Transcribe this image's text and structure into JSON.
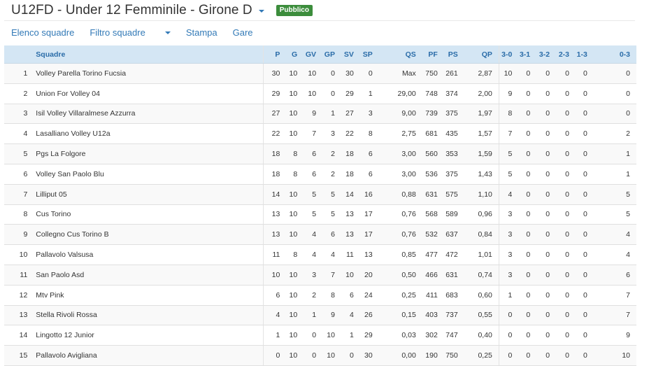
{
  "header": {
    "title": "U12FD - Under 12 Femminile - Girone D",
    "badge": "Pubblico"
  },
  "nav": {
    "items": [
      "Elenco squadre",
      "Filtro squadre",
      "Stampa",
      "Gare"
    ]
  },
  "table": {
    "columns": [
      "",
      "Squadre",
      "P",
      "G",
      "GV",
      "GP",
      "SV",
      "SP",
      "QS",
      "PF",
      "PS",
      "QP",
      "3-0",
      "3-1",
      "3-2",
      "2-3",
      "1-3",
      "0-3"
    ],
    "rows": [
      [
        "1",
        "Volley Parella Torino Fucsia",
        "30",
        "10",
        "10",
        "0",
        "30",
        "0",
        "Max",
        "750",
        "261",
        "2,87",
        "10",
        "0",
        "0",
        "0",
        "0",
        "0"
      ],
      [
        "2",
        "Union For Volley 04",
        "29",
        "10",
        "10",
        "0",
        "29",
        "1",
        "29,00",
        "748",
        "374",
        "2,00",
        "9",
        "0",
        "0",
        "0",
        "0",
        "0"
      ],
      [
        "3",
        "Isil Volley Villaralmese Azzurra",
        "27",
        "10",
        "9",
        "1",
        "27",
        "3",
        "9,00",
        "739",
        "375",
        "1,97",
        "8",
        "0",
        "0",
        "0",
        "0",
        "0"
      ],
      [
        "4",
        "Lasalliano Volley U12a",
        "22",
        "10",
        "7",
        "3",
        "22",
        "8",
        "2,75",
        "681",
        "435",
        "1,57",
        "7",
        "0",
        "0",
        "0",
        "0",
        "2"
      ],
      [
        "5",
        "Pgs La Folgore",
        "18",
        "8",
        "6",
        "2",
        "18",
        "6",
        "3,00",
        "560",
        "353",
        "1,59",
        "5",
        "0",
        "0",
        "0",
        "0",
        "1"
      ],
      [
        "6",
        "Volley San Paolo Blu",
        "18",
        "8",
        "6",
        "2",
        "18",
        "6",
        "3,00",
        "536",
        "375",
        "1,43",
        "5",
        "0",
        "0",
        "0",
        "0",
        "1"
      ],
      [
        "7",
        "Lilliput 05",
        "14",
        "10",
        "5",
        "5",
        "14",
        "16",
        "0,88",
        "631",
        "575",
        "1,10",
        "4",
        "0",
        "0",
        "0",
        "0",
        "5"
      ],
      [
        "8",
        "Cus Torino",
        "13",
        "10",
        "5",
        "5",
        "13",
        "17",
        "0,76",
        "568",
        "589",
        "0,96",
        "3",
        "0",
        "0",
        "0",
        "0",
        "5"
      ],
      [
        "9",
        "Collegno Cus Torino B",
        "13",
        "10",
        "4",
        "6",
        "13",
        "17",
        "0,76",
        "532",
        "637",
        "0,84",
        "3",
        "0",
        "0",
        "0",
        "0",
        "4"
      ],
      [
        "10",
        "Pallavolo Valsusa",
        "11",
        "8",
        "4",
        "4",
        "11",
        "13",
        "0,85",
        "477",
        "472",
        "1,01",
        "3",
        "0",
        "0",
        "0",
        "0",
        "4"
      ],
      [
        "11",
        "San Paolo Asd",
        "10",
        "10",
        "3",
        "7",
        "10",
        "20",
        "0,50",
        "466",
        "631",
        "0,74",
        "3",
        "0",
        "0",
        "0",
        "0",
        "6"
      ],
      [
        "12",
        "Mtv Pink",
        "6",
        "10",
        "2",
        "8",
        "6",
        "24",
        "0,25",
        "411",
        "683",
        "0,60",
        "1",
        "0",
        "0",
        "0",
        "0",
        "7"
      ],
      [
        "13",
        "Stella Rivoli Rossa",
        "4",
        "10",
        "1",
        "9",
        "4",
        "26",
        "0,15",
        "403",
        "737",
        "0,55",
        "0",
        "0",
        "0",
        "0",
        "0",
        "7"
      ],
      [
        "14",
        "Lingotto 12 Junior",
        "1",
        "10",
        "0",
        "10",
        "1",
        "29",
        "0,03",
        "302",
        "747",
        "0,40",
        "0",
        "0",
        "0",
        "0",
        "0",
        "9"
      ],
      [
        "15",
        "Pallavolo Avigliana",
        "0",
        "10",
        "0",
        "10",
        "0",
        "30",
        "0,00",
        "190",
        "750",
        "0,25",
        "0",
        "0",
        "0",
        "0",
        "0",
        "10"
      ]
    ]
  }
}
